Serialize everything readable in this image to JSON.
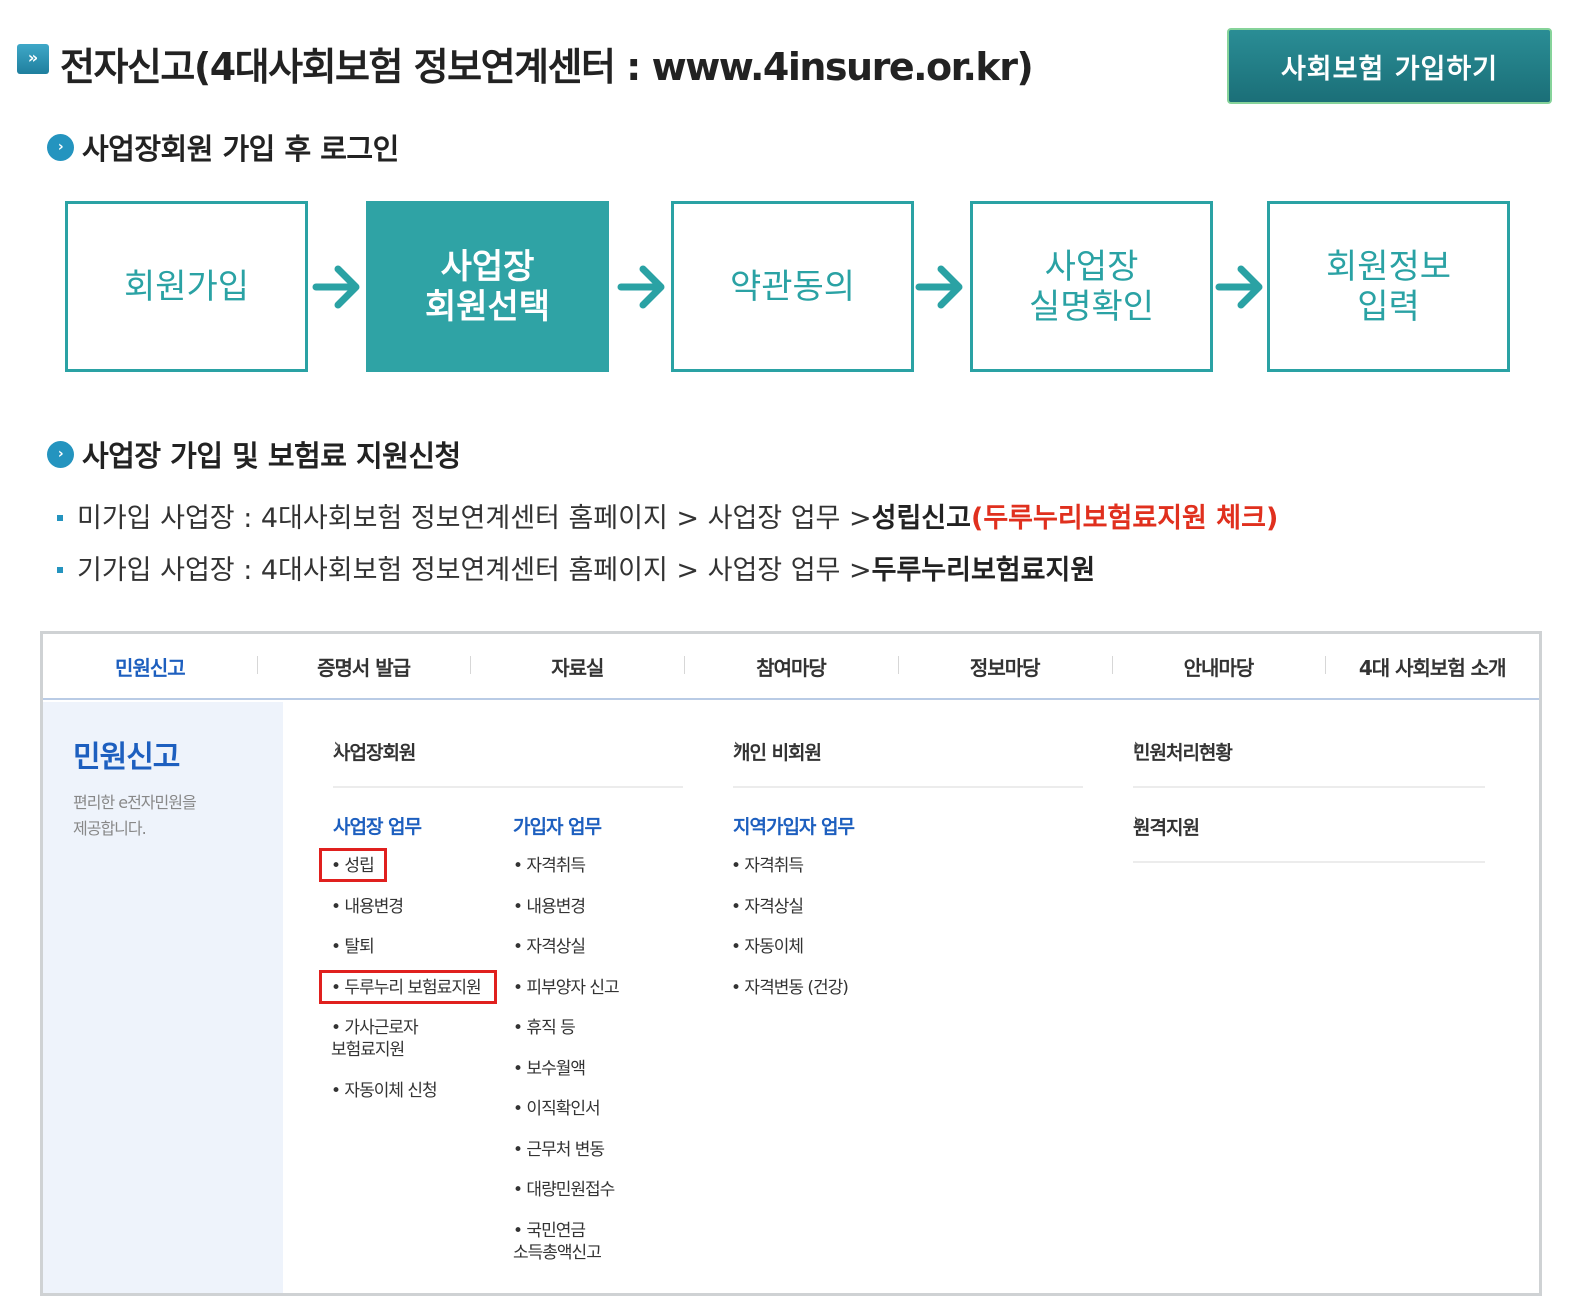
{
  "header": {
    "icon": "double-chevron-icon",
    "title": "전자신고(4대사회보험 정보연계센터 : www.4insure.or.kr)",
    "join_button": "사회보험 가입하기"
  },
  "section1": {
    "title": "사업장회원 가입 후 로그인",
    "steps": [
      {
        "label": "회원가입",
        "active": false
      },
      {
        "label": "사업장\n회원선택",
        "active": true
      },
      {
        "label": "약관동의",
        "active": false
      },
      {
        "label": "사업장\n실명확인",
        "active": false
      },
      {
        "label": "회원정보\n입력",
        "active": false
      }
    ]
  },
  "section2": {
    "title": "사업장 가입 및 보험료 지원신청",
    "line1": {
      "prefix": "미가입 사업장 : 4대사회보험 정보연계센터 홈페이지 > 사업장 업무 > ",
      "bold": "성립신고",
      "red": " (두루누리보험료지원 체크)"
    },
    "line2": {
      "prefix": "기가입 사업장 : 4대사회보험 정보연계센터 홈페이지 > 사업장 업무 > ",
      "bold": "두루누리보험료지원"
    }
  },
  "screenshot": {
    "nav": [
      "민원신고",
      "증명서 발급",
      "자료실",
      "참여마당",
      "정보마당",
      "안내마당",
      "4대 사회보험 소개"
    ],
    "left_title": "민원신고",
    "left_desc": "편리한 e전자민원을\n제공합니다.",
    "row_links": {
      "business_member": "사업장회원",
      "individual_nonmember": "개인 비회원",
      "status": "민원처리현황",
      "remote": "원격지원",
      "chevron": "›"
    },
    "col_business": {
      "title": "사업장 업무",
      "items": [
        "• 성립",
        "• 내용변경",
        "• 탈퇴",
        "• 두루누리 보험료지원",
        "• 가사근로자\n  보험료지원",
        "• 자동이체 신청"
      ]
    },
    "col_subscriber": {
      "title": "가입자 업무",
      "items": [
        "• 자격취득",
        "• 내용변경",
        "• 자격상실",
        "• 피부양자 신고",
        "• 휴직 등",
        "• 보수월액",
        "• 이직확인서",
        "• 근무처 변동",
        "• 대량민원접수",
        "• 국민연금\n  소득총액신고"
      ]
    },
    "col_regional": {
      "title": "지역가입자 업무",
      "items": [
        "• 자격취득",
        "• 자격상실",
        "• 자동이체",
        "• 자격변동 (건강)"
      ]
    }
  },
  "colors": {
    "teal": "#2aa2a4",
    "blue": "#1d5fbf",
    "red": "#e0301e"
  }
}
